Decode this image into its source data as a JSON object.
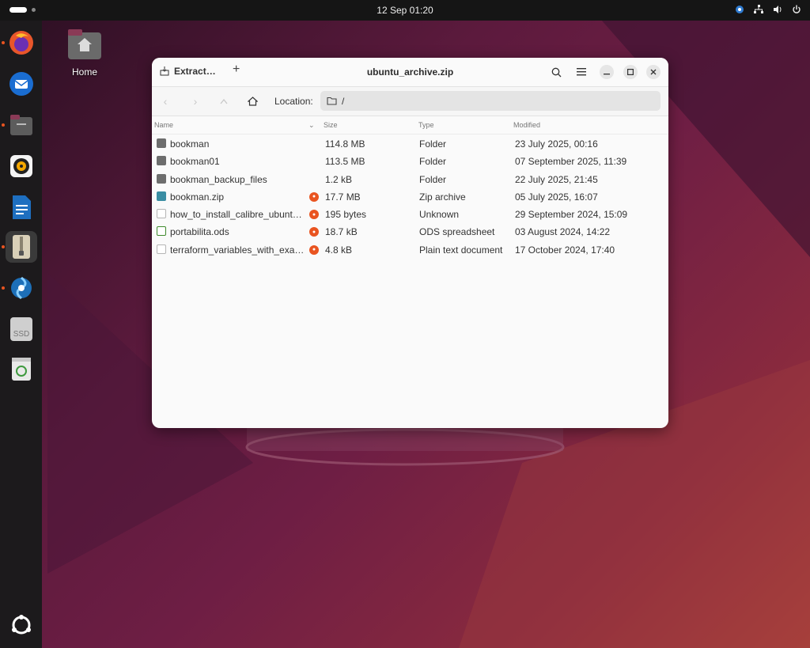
{
  "topbar": {
    "datetime": "12 Sep  01:20"
  },
  "desktop": {
    "home_label": "Home"
  },
  "dock": {
    "items": [
      {
        "name": "firefox-icon"
      },
      {
        "name": "thunderbird-icon"
      },
      {
        "name": "files-icon"
      },
      {
        "name": "rhythmbox-icon"
      },
      {
        "name": "writer-icon"
      },
      {
        "name": "archive-manager-icon"
      },
      {
        "name": "app-icon"
      },
      {
        "name": "ssd-drive-icon",
        "label": "SSD"
      },
      {
        "name": "trash-icon"
      },
      {
        "name": "show-apps-icon"
      }
    ]
  },
  "window": {
    "tab_label": "Extract…",
    "title": "ubuntu_archive.zip",
    "location_label": "Location:",
    "location_path": "/"
  },
  "columns": {
    "name": "Name",
    "size": "Size",
    "type": "Type",
    "modified": "Modified"
  },
  "files": [
    {
      "name": "bookman",
      "size": "114.8 MB",
      "type": "Folder",
      "modified": "23 July 2025, 00:16",
      "kind": "folder",
      "locked": false
    },
    {
      "name": "bookman01",
      "size": "113.5 MB",
      "type": "Folder",
      "modified": "07 September 2025, 11:39",
      "kind": "folder",
      "locked": false
    },
    {
      "name": "bookman_backup_files",
      "size": "1.2 kB",
      "type": "Folder",
      "modified": "22 July 2025, 21:45",
      "kind": "folder",
      "locked": false
    },
    {
      "name": "bookman.zip",
      "size": "17.7 MB",
      "type": "Zip archive",
      "modified": "05 July 2025, 16:07",
      "kind": "zip",
      "locked": true
    },
    {
      "name": "how_to_install_calibre_ubunt…",
      "size": "195 bytes",
      "type": "Unknown",
      "modified": "29 September 2024, 15:09",
      "kind": "txt",
      "locked": true
    },
    {
      "name": "portabilita.ods",
      "size": "18.7 kB",
      "type": "ODS spreadsheet",
      "modified": "03 August 2024, 14:22",
      "kind": "ods",
      "locked": true
    },
    {
      "name": "terraform_variables_with_exa…",
      "size": "4.8 kB",
      "type": "Plain text document",
      "modified": "17 October 2024, 17:40",
      "kind": "txt",
      "locked": true
    }
  ]
}
